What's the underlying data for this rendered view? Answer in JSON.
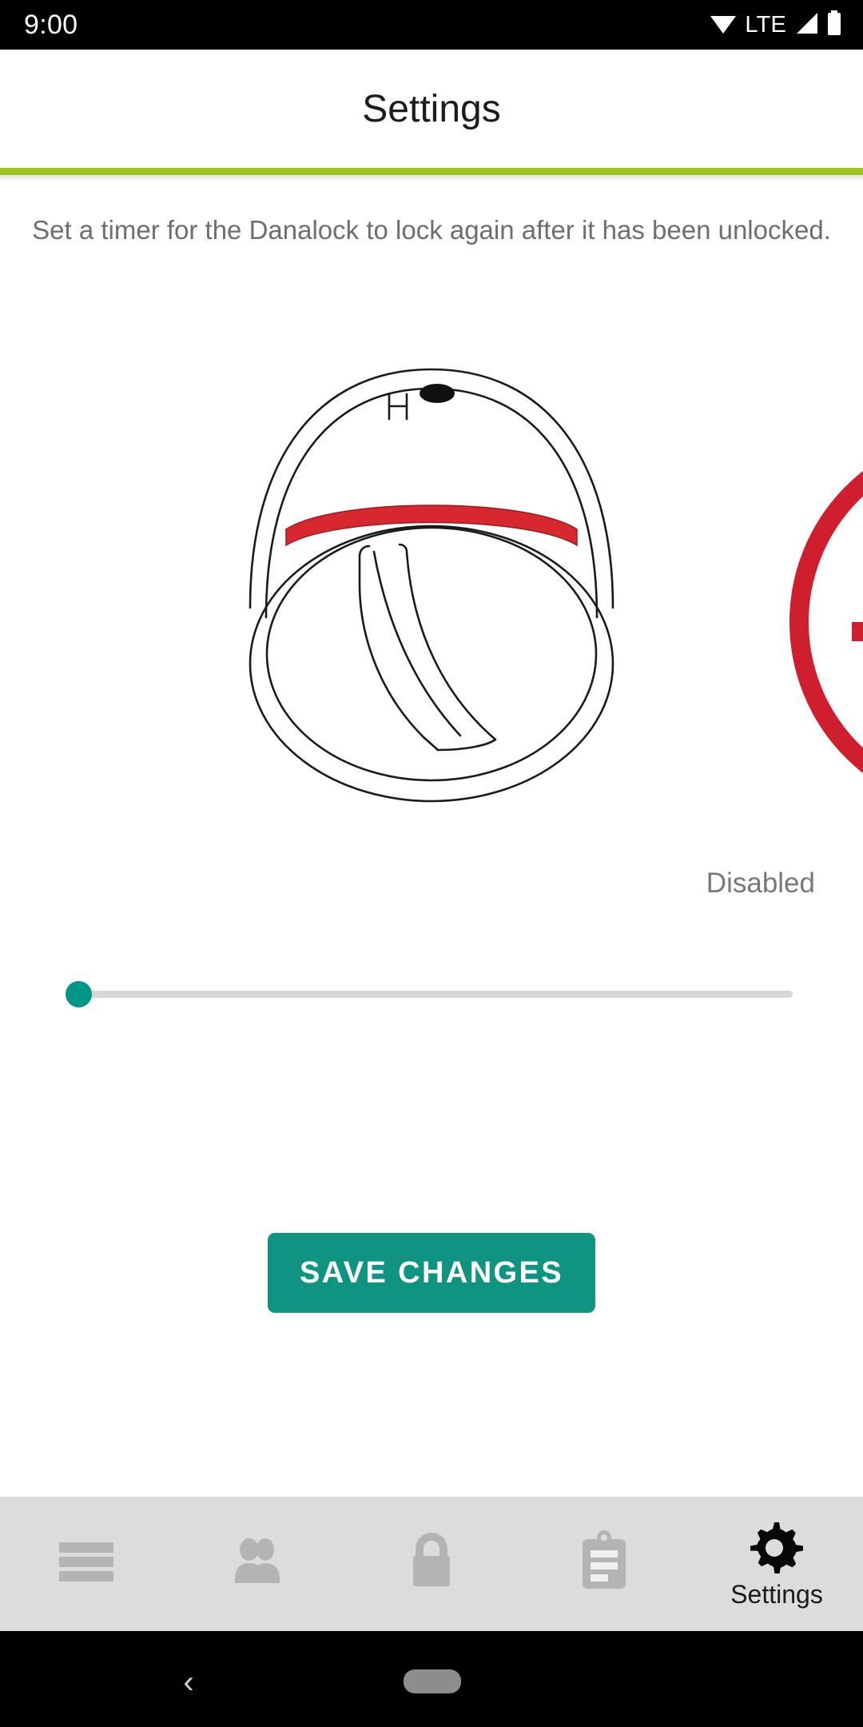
{
  "status_bar": {
    "time": "9:00",
    "network_label": "LTE",
    "icons": [
      "wifi-icon",
      "signal-icon",
      "battery-icon"
    ]
  },
  "app_bar": {
    "title": "Settings",
    "accent_color": "#9ac41f"
  },
  "main": {
    "description": "Set a timer for the Danalock to lock again after it has been unlocked.",
    "illustration": {
      "name": "danalock-device-illustration",
      "band_color": "#d8282f",
      "badge_icon": "clock-icon",
      "badge_color": "#cf1f2e"
    },
    "timer": {
      "value_label": "Disabled",
      "slider": {
        "value": 0,
        "min": 0,
        "max": 100,
        "thumb_color": "#009688",
        "track_color": "#d7d7d7"
      }
    },
    "save_button": {
      "label": "SAVE CHANGES",
      "color": "#0e9480"
    }
  },
  "bottom_nav": {
    "active_index": 4,
    "items": [
      {
        "label": "",
        "icon": "menu-icon"
      },
      {
        "label": "",
        "icon": "people-icon"
      },
      {
        "label": "",
        "icon": "lock-icon"
      },
      {
        "label": "",
        "icon": "clipboard-icon"
      },
      {
        "label": "Settings",
        "icon": "gear-icon"
      }
    ]
  },
  "system_nav": {
    "back_glyph": "‹",
    "home_pill": "home-pill"
  }
}
